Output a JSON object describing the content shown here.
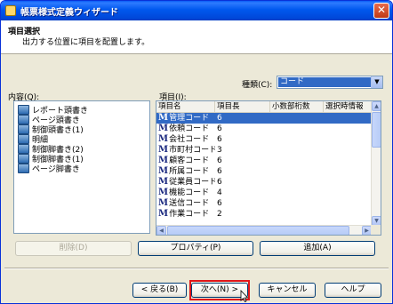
{
  "window": {
    "title": "帳票様式定義ウィザード",
    "close_glyph": "✕"
  },
  "header": {
    "title": "項目選択",
    "subtitle": "出力する位置に項目を配置します。"
  },
  "type_selector": {
    "label": "種類(C):",
    "value": "コード",
    "arrow_glyph": "▼"
  },
  "contents_label": "内容(Q):",
  "items_label": "項目(I):",
  "tree": {
    "items": [
      "レポート頭書き",
      "ページ頭書き",
      "制御頭書き(1)",
      "明細",
      "制御脚書き(2)",
      "制御脚書き(1)",
      "ページ脚書き"
    ]
  },
  "list": {
    "columns": [
      "項目名",
      "項目長",
      "小数部桁数",
      "選択時情報"
    ],
    "badge": "M",
    "rows": [
      {
        "name": "管理コード",
        "length": "6"
      },
      {
        "name": "依頼コード",
        "length": "6"
      },
      {
        "name": "会社コード",
        "length": "6"
      },
      {
        "name": "市町村コード",
        "length": "3"
      },
      {
        "name": "顧客コード",
        "length": "6"
      },
      {
        "name": "所属コード",
        "length": "6"
      },
      {
        "name": "従業員コード",
        "length": "6"
      },
      {
        "name": "機能コード",
        "length": "4"
      },
      {
        "name": "送信コード",
        "length": "6"
      },
      {
        "name": "作業コード",
        "length": "2"
      }
    ],
    "selected_index": 0,
    "scroll_up": "▲",
    "scroll_down": "▼",
    "scroll_left": "◀",
    "scroll_right": "▶"
  },
  "buttons": {
    "delete": "削除(D)",
    "properties": "プロパティ(P)",
    "add": "追加(A)",
    "back": "< 戻る(B)",
    "next": "次へ(N) >",
    "cancel": "キャンセル",
    "help": "ヘルプ"
  }
}
